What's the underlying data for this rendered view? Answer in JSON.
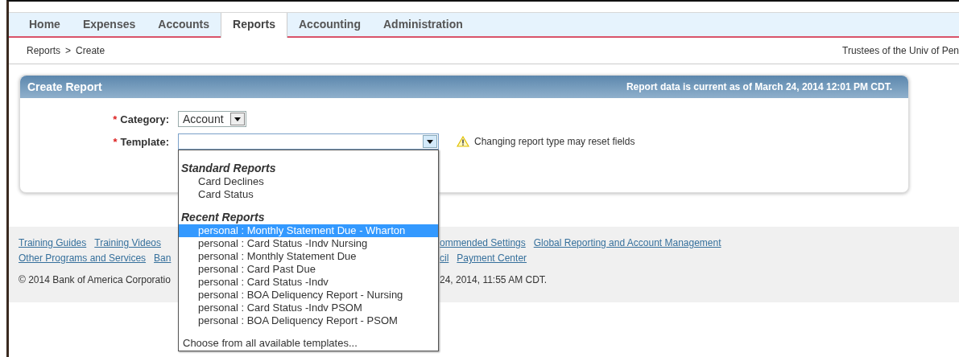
{
  "nav": {
    "tabs": [
      {
        "label": "Home",
        "selected": false
      },
      {
        "label": "Expenses",
        "selected": false
      },
      {
        "label": "Accounts",
        "selected": false
      },
      {
        "label": "Reports",
        "selected": true
      },
      {
        "label": "Accounting",
        "selected": false
      },
      {
        "label": "Administration",
        "selected": false
      }
    ]
  },
  "breadcrumb": {
    "items": [
      "Reports",
      "Create"
    ],
    "separator": ">"
  },
  "organization": "Trustees of the Univ of Pen",
  "panel": {
    "title": "Create Report",
    "data_note": "Report data is current as of March 24, 2014 12:01 PM CDT.",
    "fields": [
      {
        "label": "Category:",
        "required_mark": "*",
        "value": "Account",
        "kind": "small"
      },
      {
        "label": "Template:",
        "required_mark": "*",
        "kind": "wide",
        "focused": true
      }
    ],
    "warning": "Changing report type may reset fields"
  },
  "dropdown": {
    "groups": [
      {
        "heading": "Standard Reports",
        "items": [
          {
            "label": "Card Declines",
            "selected": false
          },
          {
            "label": "Card Status",
            "selected": false
          }
        ]
      },
      {
        "heading": "Recent Reports",
        "items": [
          {
            "label": "personal : Monthly Statement Due - Wharton",
            "selected": true
          },
          {
            "label": "personal : Card Status -Indv Nursing",
            "selected": false
          },
          {
            "label": "personal : Monthly Statement Due",
            "selected": false
          },
          {
            "label": "personal : Card Past Due",
            "selected": false
          },
          {
            "label": "personal : Card Status -Indv",
            "selected": false
          },
          {
            "label": "personal : BOA Deliquency Report - Nursing",
            "selected": false
          },
          {
            "label": "personal : Card Status -Indv PSOM",
            "selected": false
          },
          {
            "label": "personal : BOA Deliquency Report - PSOM",
            "selected": false
          }
        ]
      }
    ],
    "footer_option": "Choose from all available templates..."
  },
  "footer": {
    "left_rows": [
      [
        {
          "text": "Training Guides",
          "kind": "link"
        },
        {
          "text": "Training Videos",
          "kind": "link"
        }
      ],
      [
        {
          "text": "Other Programs and Services",
          "kind": "link"
        },
        {
          "text": "Ban",
          "kind": "link"
        }
      ],
      [
        {
          "text": "© 2014 Bank of America Corporatio",
          "kind": "text"
        }
      ]
    ],
    "right_rows": [
      [
        {
          "text": "ommended Settings",
          "kind": "link"
        },
        {
          "text": "Global Reporting and Account Management",
          "kind": "link"
        }
      ],
      [
        {
          "text": "cil",
          "kind": "link"
        },
        {
          "text": "Payment Center",
          "kind": "link"
        }
      ],
      [
        {
          "text": "24, 2014, 11:55 AM CDT.",
          "kind": "text"
        }
      ]
    ]
  }
}
